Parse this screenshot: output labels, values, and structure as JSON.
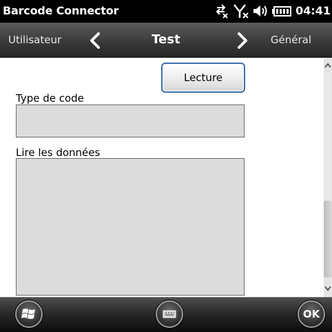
{
  "status_bar": {
    "app_title": "Barcode Connector",
    "time": "04:41",
    "icons": [
      "data-sync-icon",
      "signal-off-icon",
      "volume-icon",
      "battery-icon"
    ]
  },
  "header": {
    "prev_label": "Utilisateur",
    "title": "Test",
    "next_label": "Général",
    "icons": [
      "chevron-left-icon",
      "chevron-right-icon"
    ]
  },
  "content": {
    "read_button_label": "Lecture",
    "code_type_label": "Type de code",
    "code_type_value": "",
    "read_data_label": "Lire les données",
    "read_data_value": ""
  },
  "softkeys": {
    "ok_label": "OK",
    "icons": [
      "windows-start-icon",
      "keyboard-icon"
    ]
  },
  "colors": {
    "button_border": "#3c6ea8",
    "field_bg": "#dcdcdc",
    "bar_bg": "#3a3a3a"
  }
}
